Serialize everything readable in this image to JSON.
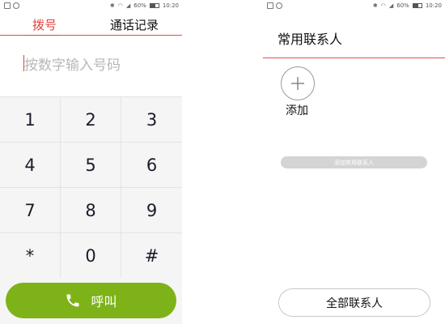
{
  "status_bar": {
    "battery": "60%",
    "time": "10:20"
  },
  "dialer": {
    "tabs": {
      "dial": "拨号",
      "call_log": "通话记录"
    },
    "input_placeholder": "按数字输入号码",
    "keys": [
      "1",
      "2",
      "3",
      "4",
      "5",
      "6",
      "7",
      "8",
      "9",
      "*",
      "0",
      "#"
    ],
    "call_label": "呼叫",
    "accent_color": "#e0403c",
    "call_color": "#7db318"
  },
  "favorites": {
    "title": "常用联系人",
    "add_label": "添加",
    "add_favorite_label": "添加常用联系人",
    "all_contacts_label": "全部联系人"
  }
}
